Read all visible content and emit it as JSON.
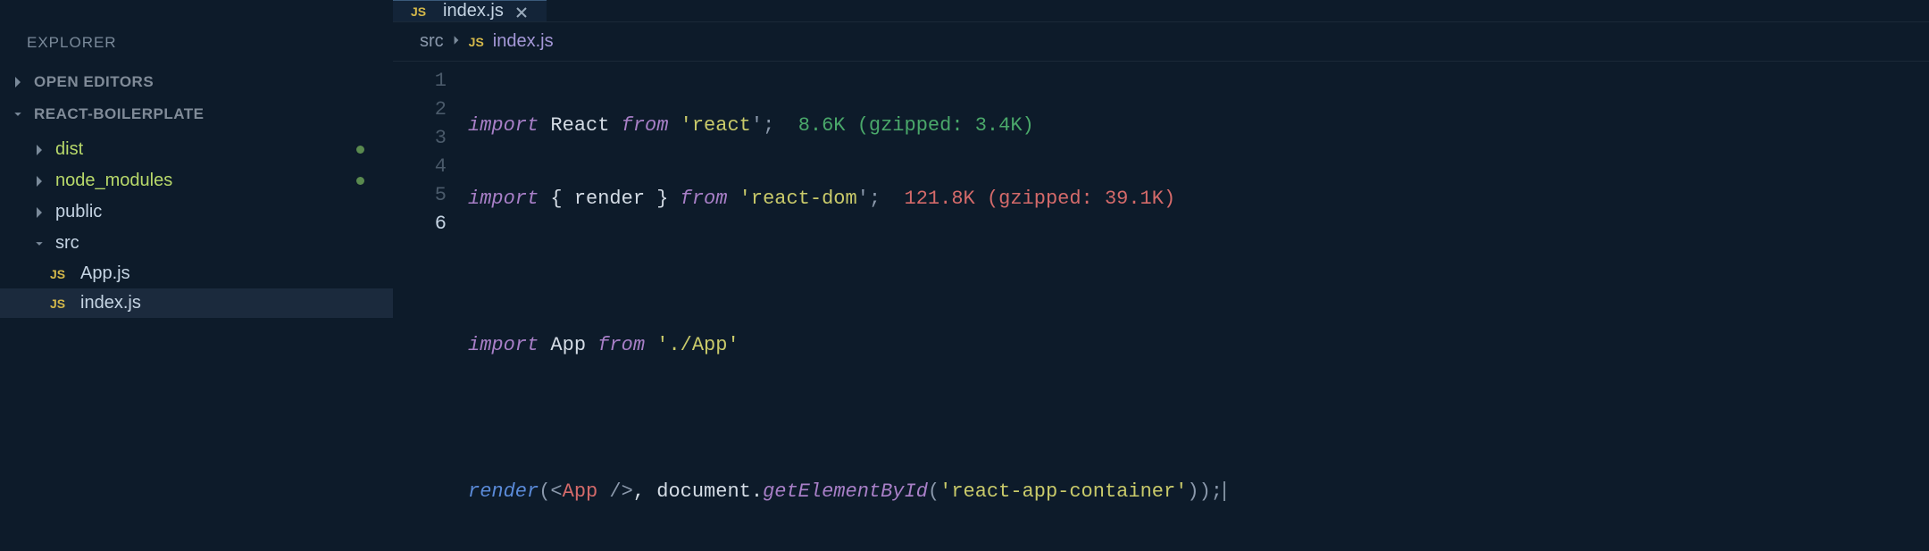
{
  "sidebar": {
    "title": "EXPLORER",
    "open_editors": "OPEN EDITORS",
    "project": "REACT-BOILERPLATE",
    "items": [
      {
        "label": "dist",
        "kind": "folder",
        "green": true,
        "dot": true
      },
      {
        "label": "node_modules",
        "kind": "folder",
        "green": true,
        "dot": true
      },
      {
        "label": "public",
        "kind": "folder",
        "green": false,
        "dot": false
      },
      {
        "label": "src",
        "kind": "folder-open",
        "green": false,
        "dot": false
      },
      {
        "label": "App.js",
        "kind": "file-js",
        "green": false,
        "dot": false
      },
      {
        "label": "index.js",
        "kind": "file-js",
        "green": false,
        "dot": false,
        "selected": true
      }
    ]
  },
  "tab": {
    "badge": "JS",
    "filename": "index.js"
  },
  "breadcrumb": {
    "folder": "src",
    "badge": "JS",
    "file": "index.js"
  },
  "code": {
    "line1": {
      "imp": "import",
      "react": " React ",
      "from": "from",
      "q1": " '",
      "mod": "react",
      "q2": "';  ",
      "hint": "8.6K (gzipped: 3.4K)"
    },
    "line2": {
      "imp": "import",
      "braces": " { render } ",
      "from": "from",
      "q1": " '",
      "mod": "react-dom",
      "q2": "';  ",
      "hint": "121.8K (gzipped: 39.1K)"
    },
    "line4": {
      "imp": "import",
      "app": " App ",
      "from": "from",
      "q1": " '",
      "mod": "./App",
      "q2": "'"
    },
    "line6": {
      "render": "render",
      "open": "(<",
      "tag": "App",
      "tagclose": " />",
      "doc": ", document.",
      "method": "getElementById",
      "paren": "(",
      "q": "'",
      "id": "react-app-container",
      "close": "));"
    }
  },
  "gutter": [
    "1",
    "2",
    "3",
    "4",
    "5",
    "6"
  ]
}
